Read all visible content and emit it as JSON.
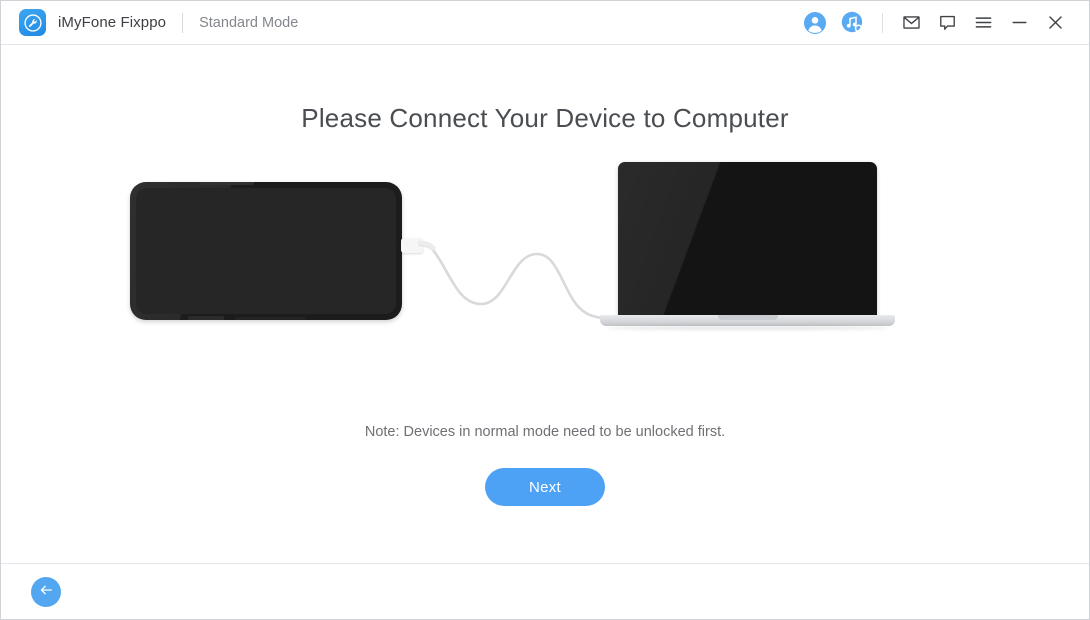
{
  "window": {
    "brand_name": "iMyFone Fixppo",
    "mode_label": "Standard Mode",
    "app_icon": "wrench-circle-icon",
    "accent_color": "#4da2f5",
    "toolbar": [
      {
        "name": "account-icon",
        "glyph": "",
        "label": "Account"
      },
      {
        "name": "music-search-icon",
        "glyph": "",
        "label": "Music Search"
      },
      {
        "name": "mail-icon",
        "glyph": "✉",
        "label": "Mail"
      },
      {
        "name": "feedback-icon",
        "glyph": "▭",
        "label": "Feedback"
      },
      {
        "name": "menu-icon",
        "glyph": "☰",
        "label": "Menu"
      },
      {
        "name": "minimize-icon",
        "glyph": "−",
        "label": "Minimize"
      },
      {
        "name": "close-icon",
        "glyph": "✕",
        "label": "Close"
      }
    ]
  },
  "main": {
    "title": "Please Connect Your Device to Computer",
    "note": "Note: Devices in normal mode need to be unlocked first.",
    "next_label": "Next",
    "illustration": {
      "phone": "black-smartphone-landscape",
      "laptop": "black-screen-laptop",
      "cable": "white-usb-lightning-cable",
      "connector": "lightning-connector"
    }
  },
  "footer": {
    "back_label": "Back",
    "back_icon": "arrow-left-icon"
  }
}
